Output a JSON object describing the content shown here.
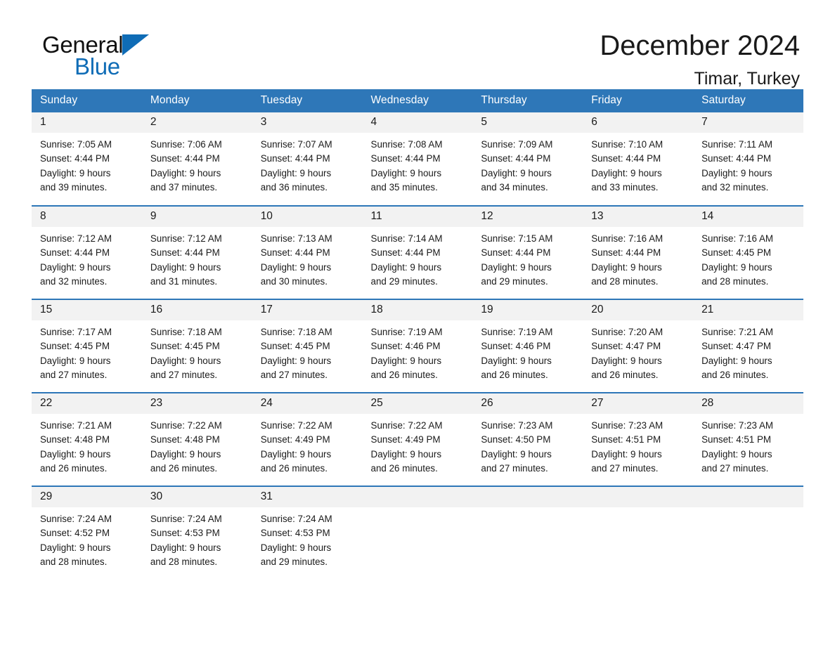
{
  "brand": {
    "name_part1": "General",
    "name_part2": "Blue",
    "triangle_icon": "blue-triangle-icon",
    "accent_color": "#0f6cb6"
  },
  "header": {
    "title": "December 2024",
    "subtitle": "Timar, Turkey"
  },
  "theme": {
    "header_bg": "#2e77b8",
    "daynum_bg": "#f2f2f2",
    "divider": "#2e77b8",
    "text": "#1a1a1a"
  },
  "weekday_headers": [
    "Sunday",
    "Monday",
    "Tuesday",
    "Wednesday",
    "Thursday",
    "Friday",
    "Saturday"
  ],
  "labels": {
    "sunrise_prefix": "Sunrise:",
    "sunset_prefix": "Sunset:",
    "daylight_prefix": "Daylight:"
  },
  "weeks": [
    [
      {
        "day": "1",
        "line1": "Sunrise: 7:05 AM",
        "line2": "Sunset: 4:44 PM",
        "line3": "Daylight: 9 hours",
        "line4": "and 39 minutes."
      },
      {
        "day": "2",
        "line1": "Sunrise: 7:06 AM",
        "line2": "Sunset: 4:44 PM",
        "line3": "Daylight: 9 hours",
        "line4": "and 37 minutes."
      },
      {
        "day": "3",
        "line1": "Sunrise: 7:07 AM",
        "line2": "Sunset: 4:44 PM",
        "line3": "Daylight: 9 hours",
        "line4": "and 36 minutes."
      },
      {
        "day": "4",
        "line1": "Sunrise: 7:08 AM",
        "line2": "Sunset: 4:44 PM",
        "line3": "Daylight: 9 hours",
        "line4": "and 35 minutes."
      },
      {
        "day": "5",
        "line1": "Sunrise: 7:09 AM",
        "line2": "Sunset: 4:44 PM",
        "line3": "Daylight: 9 hours",
        "line4": "and 34 minutes."
      },
      {
        "day": "6",
        "line1": "Sunrise: 7:10 AM",
        "line2": "Sunset: 4:44 PM",
        "line3": "Daylight: 9 hours",
        "line4": "and 33 minutes."
      },
      {
        "day": "7",
        "line1": "Sunrise: 7:11 AM",
        "line2": "Sunset: 4:44 PM",
        "line3": "Daylight: 9 hours",
        "line4": "and 32 minutes."
      }
    ],
    [
      {
        "day": "8",
        "line1": "Sunrise: 7:12 AM",
        "line2": "Sunset: 4:44 PM",
        "line3": "Daylight: 9 hours",
        "line4": "and 32 minutes."
      },
      {
        "day": "9",
        "line1": "Sunrise: 7:12 AM",
        "line2": "Sunset: 4:44 PM",
        "line3": "Daylight: 9 hours",
        "line4": "and 31 minutes."
      },
      {
        "day": "10",
        "line1": "Sunrise: 7:13 AM",
        "line2": "Sunset: 4:44 PM",
        "line3": "Daylight: 9 hours",
        "line4": "and 30 minutes."
      },
      {
        "day": "11",
        "line1": "Sunrise: 7:14 AM",
        "line2": "Sunset: 4:44 PM",
        "line3": "Daylight: 9 hours",
        "line4": "and 29 minutes."
      },
      {
        "day": "12",
        "line1": "Sunrise: 7:15 AM",
        "line2": "Sunset: 4:44 PM",
        "line3": "Daylight: 9 hours",
        "line4": "and 29 minutes."
      },
      {
        "day": "13",
        "line1": "Sunrise: 7:16 AM",
        "line2": "Sunset: 4:44 PM",
        "line3": "Daylight: 9 hours",
        "line4": "and 28 minutes."
      },
      {
        "day": "14",
        "line1": "Sunrise: 7:16 AM",
        "line2": "Sunset: 4:45 PM",
        "line3": "Daylight: 9 hours",
        "line4": "and 28 minutes."
      }
    ],
    [
      {
        "day": "15",
        "line1": "Sunrise: 7:17 AM",
        "line2": "Sunset: 4:45 PM",
        "line3": "Daylight: 9 hours",
        "line4": "and 27 minutes."
      },
      {
        "day": "16",
        "line1": "Sunrise: 7:18 AM",
        "line2": "Sunset: 4:45 PM",
        "line3": "Daylight: 9 hours",
        "line4": "and 27 minutes."
      },
      {
        "day": "17",
        "line1": "Sunrise: 7:18 AM",
        "line2": "Sunset: 4:45 PM",
        "line3": "Daylight: 9 hours",
        "line4": "and 27 minutes."
      },
      {
        "day": "18",
        "line1": "Sunrise: 7:19 AM",
        "line2": "Sunset: 4:46 PM",
        "line3": "Daylight: 9 hours",
        "line4": "and 26 minutes."
      },
      {
        "day": "19",
        "line1": "Sunrise: 7:19 AM",
        "line2": "Sunset: 4:46 PM",
        "line3": "Daylight: 9 hours",
        "line4": "and 26 minutes."
      },
      {
        "day": "20",
        "line1": "Sunrise: 7:20 AM",
        "line2": "Sunset: 4:47 PM",
        "line3": "Daylight: 9 hours",
        "line4": "and 26 minutes."
      },
      {
        "day": "21",
        "line1": "Sunrise: 7:21 AM",
        "line2": "Sunset: 4:47 PM",
        "line3": "Daylight: 9 hours",
        "line4": "and 26 minutes."
      }
    ],
    [
      {
        "day": "22",
        "line1": "Sunrise: 7:21 AM",
        "line2": "Sunset: 4:48 PM",
        "line3": "Daylight: 9 hours",
        "line4": "and 26 minutes."
      },
      {
        "day": "23",
        "line1": "Sunrise: 7:22 AM",
        "line2": "Sunset: 4:48 PM",
        "line3": "Daylight: 9 hours",
        "line4": "and 26 minutes."
      },
      {
        "day": "24",
        "line1": "Sunrise: 7:22 AM",
        "line2": "Sunset: 4:49 PM",
        "line3": "Daylight: 9 hours",
        "line4": "and 26 minutes."
      },
      {
        "day": "25",
        "line1": "Sunrise: 7:22 AM",
        "line2": "Sunset: 4:49 PM",
        "line3": "Daylight: 9 hours",
        "line4": "and 26 minutes."
      },
      {
        "day": "26",
        "line1": "Sunrise: 7:23 AM",
        "line2": "Sunset: 4:50 PM",
        "line3": "Daylight: 9 hours",
        "line4": "and 27 minutes."
      },
      {
        "day": "27",
        "line1": "Sunrise: 7:23 AM",
        "line2": "Sunset: 4:51 PM",
        "line3": "Daylight: 9 hours",
        "line4": "and 27 minutes."
      },
      {
        "day": "28",
        "line1": "Sunrise: 7:23 AM",
        "line2": "Sunset: 4:51 PM",
        "line3": "Daylight: 9 hours",
        "line4": "and 27 minutes."
      }
    ],
    [
      {
        "day": "29",
        "line1": "Sunrise: 7:24 AM",
        "line2": "Sunset: 4:52 PM",
        "line3": "Daylight: 9 hours",
        "line4": "and 28 minutes."
      },
      {
        "day": "30",
        "line1": "Sunrise: 7:24 AM",
        "line2": "Sunset: 4:53 PM",
        "line3": "Daylight: 9 hours",
        "line4": "and 28 minutes."
      },
      {
        "day": "31",
        "line1": "Sunrise: 7:24 AM",
        "line2": "Sunset: 4:53 PM",
        "line3": "Daylight: 9 hours",
        "line4": "and 29 minutes."
      },
      {
        "day": "",
        "line1": "",
        "line2": "",
        "line3": "",
        "line4": ""
      },
      {
        "day": "",
        "line1": "",
        "line2": "",
        "line3": "",
        "line4": ""
      },
      {
        "day": "",
        "line1": "",
        "line2": "",
        "line3": "",
        "line4": ""
      },
      {
        "day": "",
        "line1": "",
        "line2": "",
        "line3": "",
        "line4": ""
      }
    ]
  ]
}
